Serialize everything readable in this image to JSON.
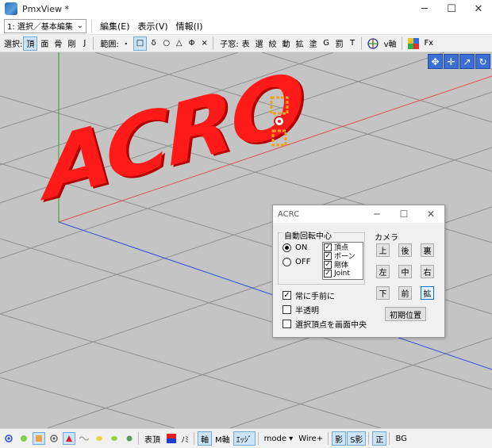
{
  "window": {
    "title": "PmxView *",
    "minimize": "─",
    "maximize": "☐",
    "close": "✕"
  },
  "menu": {
    "mode_value": "1: 選択／基本編集",
    "items": [
      "編集(E)",
      "表示(V)",
      "情報(I)"
    ]
  },
  "toolbar": {
    "select_label": "選択:",
    "select_items": [
      "頂",
      "面",
      "骨",
      "剛",
      "J"
    ],
    "range_label": "範囲:",
    "range_items": [
      "・",
      "□",
      "δ",
      "○",
      "△",
      "Φ",
      "×"
    ],
    "sub_label": "子窓:",
    "sub_items": [
      "表",
      "選",
      "絞",
      "動",
      "拡",
      "塗",
      "G",
      "罰",
      "T"
    ],
    "vaxis_label": "v軸",
    "fx_label": "Fx"
  },
  "viewport": {
    "model_text": "ACRO",
    "text_color": "#ff1a1a"
  },
  "dialog": {
    "title": "ACRC",
    "auto_rot_label": "自動回転中心",
    "on_label": "ON",
    "off_label": "OFF",
    "checks": [
      "頂点",
      "ボーン",
      "剛体",
      "Joint"
    ],
    "camera_label": "カメラ",
    "camera_buttons": [
      "上",
      "後",
      "裏",
      "左",
      "中",
      "右",
      "下",
      "前",
      "拡"
    ],
    "options": [
      {
        "label": "常に手前に",
        "checked": "✓"
      },
      {
        "label": "半透明",
        "checked": ""
      },
      {
        "label": "選択頂点を画面中央",
        "checked": ""
      }
    ],
    "reset_label": "初期位置"
  },
  "statusbar": {
    "items_a": [
      "表頂",
      "ﾉﾐ"
    ],
    "items_b": [
      "軸",
      "M軸",
      "ｴｯｼﾞ"
    ],
    "mode_label": "mode ▾",
    "wire_label": "Wire+",
    "items_c": [
      "影",
      "S影",
      "正",
      "BG"
    ]
  }
}
